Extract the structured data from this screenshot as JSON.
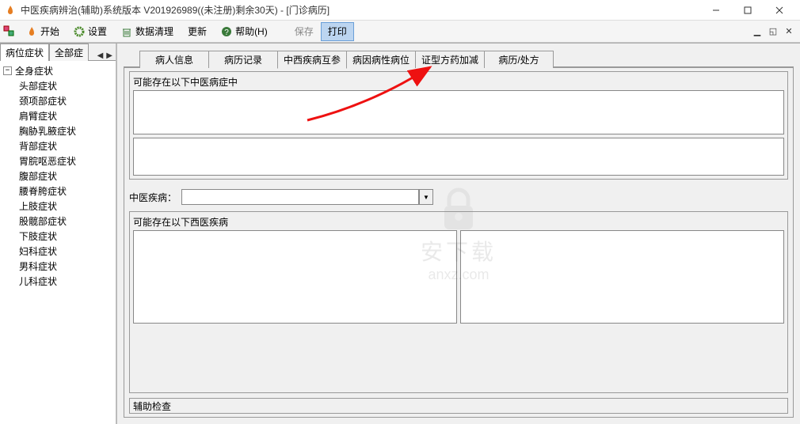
{
  "titlebar": {
    "title": "中医疾病辨治(辅助)系统版本 V201926989((未注册)剩余30天) - [门诊病历]"
  },
  "menubar": {
    "items": [
      {
        "label": "开始",
        "icon": "flame"
      },
      {
        "label": "设置",
        "icon": "gear"
      },
      {
        "label": "数据清理",
        "icon": "trash"
      },
      {
        "label": "更新",
        "icon": null
      },
      {
        "label": "帮助(H)",
        "icon": "help"
      },
      {
        "label": "保存",
        "icon": null,
        "disabled": true
      },
      {
        "label": "打印",
        "icon": null,
        "highlighted": true
      }
    ]
  },
  "sidebar": {
    "tabs": [
      {
        "label": "病位症状",
        "active": true
      },
      {
        "label": "全部症",
        "active": false
      }
    ],
    "tree_root": "全身症状",
    "tree_items": [
      "头部症状",
      "颈项部症状",
      "肩臂症状",
      "胸胁乳腋症状",
      "背部症状",
      "胃脘呕恶症状",
      "腹部症状",
      "腰脊胯症状",
      "上肢症状",
      "股髋部症状",
      "下肢症状",
      "妇科症状",
      "男科症状",
      "儿科症状"
    ]
  },
  "main": {
    "tabs": [
      {
        "label": "病人信息"
      },
      {
        "label": "病历记录"
      },
      {
        "label": "中西疾病互参",
        "active": true
      },
      {
        "label": "病因病性病位"
      },
      {
        "label": "证型方药加减"
      },
      {
        "label": "病历/处方"
      }
    ],
    "section1_label": "可能存在以下中医病症中",
    "field_label": "中医疾病：",
    "field_value": "",
    "section2_label": "可能存在以下西医疾病",
    "section3_label": "辅助检查"
  },
  "watermark": {
    "text1": "安下载",
    "text2": "anxz.com"
  }
}
